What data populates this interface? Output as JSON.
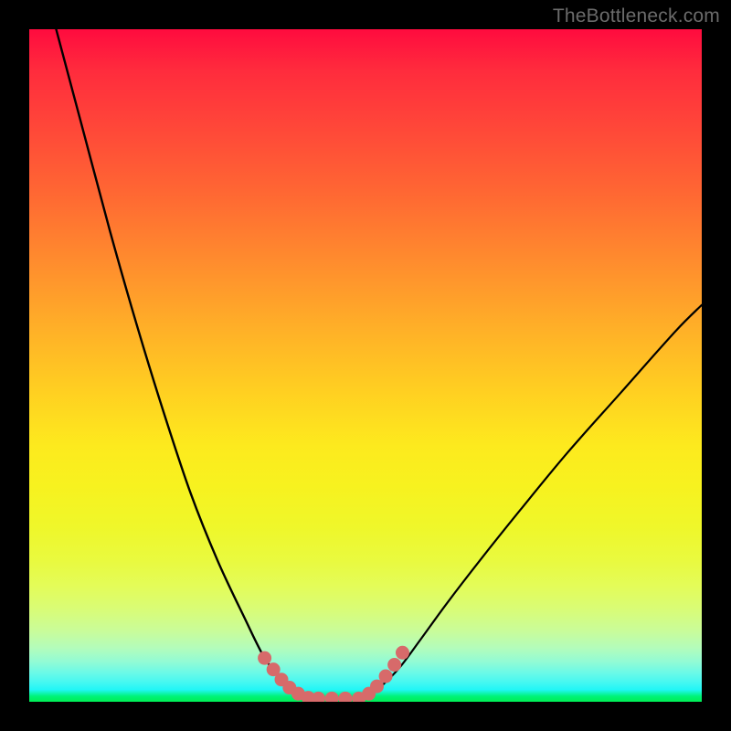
{
  "watermark": "TheBottleneck.com",
  "chart_data": {
    "type": "line",
    "title": "",
    "xlabel": "",
    "ylabel": "",
    "xlim": [
      0,
      100
    ],
    "ylim": [
      0,
      100
    ],
    "grid": false,
    "series": [
      {
        "name": "left-curve",
        "x": [
          4,
          8,
          12,
          16,
          20,
          24,
          28,
          32,
          35,
          37.5,
          40,
          42
        ],
        "y": [
          100,
          85,
          70,
          56,
          43,
          31,
          21,
          12.5,
          6.5,
          3.5,
          1.5,
          0.5
        ]
      },
      {
        "name": "right-curve",
        "x": [
          50,
          52,
          55,
          58,
          62,
          67,
          73,
          80,
          88,
          96,
          100
        ],
        "y": [
          0.5,
          2,
          5,
          9,
          14.5,
          21,
          28.5,
          37,
          46,
          55,
          59
        ]
      },
      {
        "name": "floor-segment",
        "x": [
          42,
          50
        ],
        "y": [
          0.5,
          0.5
        ]
      }
    ],
    "markers": {
      "name": "accent-dots",
      "color": "#d76a6a",
      "points": [
        {
          "x": 35.0,
          "y": 6.5
        },
        {
          "x": 36.3,
          "y": 4.8
        },
        {
          "x": 37.5,
          "y": 3.3
        },
        {
          "x": 38.7,
          "y": 2.1
        },
        {
          "x": 40.0,
          "y": 1.2
        },
        {
          "x": 41.5,
          "y": 0.6
        },
        {
          "x": 43.0,
          "y": 0.5
        },
        {
          "x": 45.0,
          "y": 0.5
        },
        {
          "x": 47.0,
          "y": 0.5
        },
        {
          "x": 49.0,
          "y": 0.5
        },
        {
          "x": 50.5,
          "y": 1.2
        },
        {
          "x": 51.7,
          "y": 2.3
        },
        {
          "x": 53.0,
          "y": 3.8
        },
        {
          "x": 54.3,
          "y": 5.5
        },
        {
          "x": 55.5,
          "y": 7.3
        }
      ]
    },
    "gradient_stops": [
      {
        "pos": 0,
        "color": "#ff0b3e"
      },
      {
        "pos": 0.5,
        "color": "#ffd021"
      },
      {
        "pos": 0.8,
        "color": "#e9fa3f"
      },
      {
        "pos": 1.0,
        "color": "#00ef55"
      }
    ]
  }
}
